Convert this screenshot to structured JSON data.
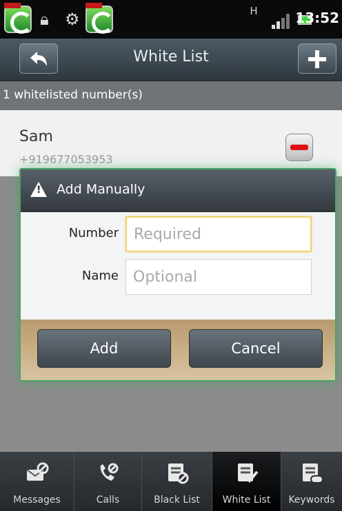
{
  "status_bar": {
    "time": "13:52",
    "network": "H"
  },
  "title_bar": {
    "title": "White List",
    "back_icon": "back-arrow-icon",
    "add_icon": "plus-icon"
  },
  "summary": {
    "count_text": "1 whitelisted number(s)"
  },
  "list": {
    "items": [
      {
        "name": "Sam",
        "number": "+919677053953"
      }
    ]
  },
  "dialog": {
    "title": "Add Manually",
    "number_label": "Number",
    "number_placeholder": "Required",
    "name_label": "Name",
    "name_placeholder": "Optional",
    "add_label": "Add",
    "cancel_label": "Cancel"
  },
  "tabs": [
    {
      "label": "Messages",
      "icon": "messages-icon"
    },
    {
      "label": "Calls",
      "icon": "calls-icon"
    },
    {
      "label": "Black List",
      "icon": "black-list-icon"
    },
    {
      "label": "White List",
      "icon": "white-list-icon",
      "active": true
    },
    {
      "label": "Keywords",
      "icon": "keywords-icon"
    }
  ],
  "colors": {
    "accent_green": "#46a466",
    "remove_red": "#dd1111",
    "focus_yellow": "#f0d26a"
  }
}
